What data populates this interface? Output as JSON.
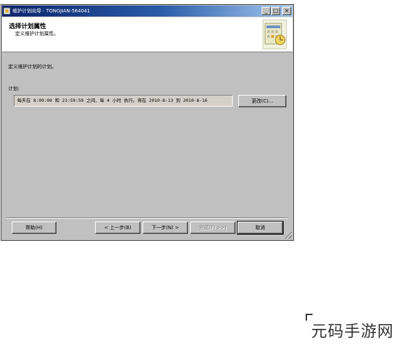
{
  "window": {
    "title": "维护计划向导 - TONGJIAN-564041",
    "min_glyph": "_",
    "max_glyph": "□",
    "close_glyph": "×"
  },
  "header": {
    "title": "选择计划属性",
    "subtitle": "定义维护计划属性。"
  },
  "body": {
    "description": "定义维护计划的计划。",
    "schedule_label": "计划:",
    "schedule_value": "每天在 8:00:00 和 23:59:59 之间、每 4 小时 执行。将在 2010-8-13 到 2010-8-16",
    "change_button": "更改(C)..."
  },
  "footer": {
    "help_button": "帮助(H)",
    "back_button": "< 上一步(B)",
    "next_button": "下一步(N) >",
    "finish_button": "完成(F) >>|",
    "cancel_button": "取消"
  },
  "watermark": {
    "text": "元码手游网"
  },
  "icons": {
    "title_icon": "wizard-app-icon",
    "header_art": "calendar-schedule-icon",
    "resize_grip": "resize-grip-icon"
  }
}
